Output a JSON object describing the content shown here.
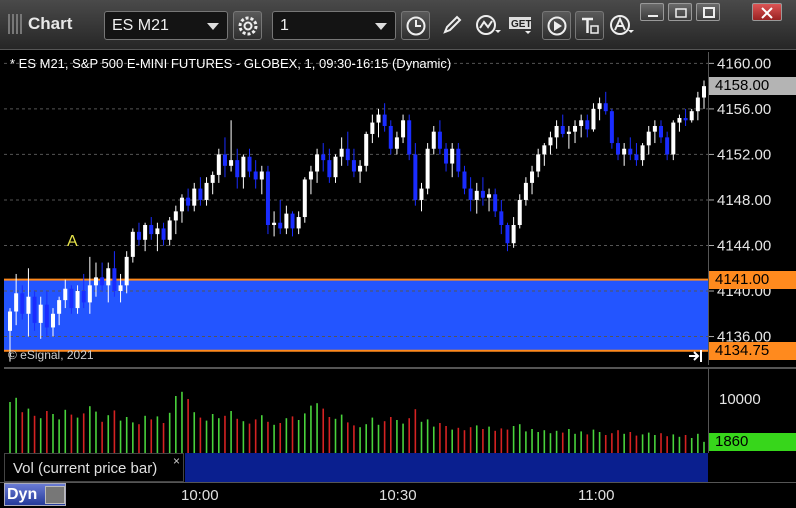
{
  "window": {
    "title": "Chart",
    "minimize_icon": "minimize-icon",
    "restore_icon": "restore-icon",
    "close_icon": "close-icon"
  },
  "toolbar": {
    "symbol": "ES M21",
    "interval": "1",
    "buttons": [
      "gear-icon",
      "clock-icon",
      "pencil-icon",
      "study-icon",
      "get-icon",
      "play-icon",
      "text-icon",
      "alert-icon"
    ],
    "get_label": "GET"
  },
  "chart": {
    "title": "* ES M21, S&P 500 E-MINI FUTURES - GLOBEX, 1, 09:30-16:15 (Dynamic)",
    "copyright": "© eSignal, 2021",
    "marker": "A",
    "current_price": "4158.00",
    "zone_high": "4141.00",
    "zone_low": "4134.75",
    "volume_label": "Vol (current price bar)",
    "volume_value": "1860",
    "volume_tick": "10000",
    "dyn_label": "Dyn",
    "close_x": "×"
  },
  "colors": {
    "up_candle": "#ffffff",
    "down_candle": "#1a2cff",
    "zone_fill": "#2355ff",
    "zone_border": "#ff8a1e",
    "vol_up": "#49d33c",
    "vol_down": "#d62222",
    "current_tag": "#b4b4b4",
    "volume_tag": "#37d61b"
  },
  "chart_data": {
    "type": "candlestick",
    "price_axis": {
      "ticks": [
        "4160.00",
        "4156.00",
        "4152.00",
        "4148.00",
        "4144.00",
        "4140.00",
        "4136.00"
      ],
      "min": 4133.5,
      "max": 4161
    },
    "time_axis": {
      "ticks": [
        "10:00",
        "10:30",
        "11:00"
      ]
    },
    "volume_axis": {
      "ticks": [
        "10000"
      ],
      "max": 14000
    },
    "candles": [
      [
        4136.5,
        4138.5,
        4133.8,
        4138.2
      ],
      [
        4138.2,
        4141.5,
        4137.0,
        4139.8
      ],
      [
        4139.8,
        4140.5,
        4137.5,
        4138.0
      ],
      [
        4138.0,
        4142.0,
        4136.0,
        4139.5
      ],
      [
        4139.5,
        4140.0,
        4136.5,
        4137.2
      ],
      [
        4137.2,
        4139.5,
        4135.8,
        4138.8
      ],
      [
        4138.8,
        4140.0,
        4136.0,
        4136.8
      ],
      [
        4136.8,
        4138.5,
        4136.0,
        4138.0
      ],
      [
        4138.0,
        4139.5,
        4137.0,
        4139.2
      ],
      [
        4139.2,
        4141.0,
        4138.5,
        4140.2
      ],
      [
        4140.2,
        4140.5,
        4138.0,
        4138.5
      ],
      [
        4138.5,
        4140.5,
        4138.0,
        4140.0
      ],
      [
        4140.0,
        4141.5,
        4138.5,
        4139.0
      ],
      [
        4139.0,
        4143.0,
        4138.0,
        4140.5
      ],
      [
        4140.5,
        4142.5,
        4139.5,
        4141.2
      ],
      [
        4141.2,
        4142.5,
        4140.0,
        4140.5
      ],
      [
        4140.5,
        4142.5,
        4139.0,
        4142.0
      ],
      [
        4142.0,
        4143.5,
        4139.5,
        4140.0
      ],
      [
        4140.0,
        4141.5,
        4139.0,
        4140.5
      ],
      [
        4140.5,
        4143.5,
        4139.8,
        4143.0
      ],
      [
        4143.0,
        4145.5,
        4142.5,
        4145.2
      ],
      [
        4145.2,
        4146.0,
        4144.0,
        4144.5
      ],
      [
        4144.5,
        4146.0,
        4143.5,
        4145.8
      ],
      [
        4145.8,
        4146.5,
        4144.5,
        4145.0
      ],
      [
        4145.0,
        4146.0,
        4143.5,
        4145.5
      ],
      [
        4145.5,
        4146.0,
        4144.0,
        4144.5
      ],
      [
        4144.5,
        4146.5,
        4144.0,
        4146.2
      ],
      [
        4146.2,
        4147.5,
        4145.0,
        4147.0
      ],
      [
        4147.0,
        4148.5,
        4146.0,
        4148.2
      ],
      [
        4148.2,
        4149.0,
        4147.0,
        4147.5
      ],
      [
        4147.5,
        4149.5,
        4147.0,
        4149.0
      ],
      [
        4149.0,
        4150.0,
        4147.5,
        4148.0
      ],
      [
        4148.0,
        4150.0,
        4147.5,
        4149.5
      ],
      [
        4149.5,
        4150.5,
        4148.5,
        4150.2
      ],
      [
        4150.2,
        4152.5,
        4149.5,
        4152.0
      ],
      [
        4152.0,
        4153.5,
        4150.0,
        4151.0
      ],
      [
        4151.0,
        4155.0,
        4150.5,
        4151.5
      ],
      [
        4151.5,
        4152.5,
        4149.0,
        4150.0
      ],
      [
        4150.0,
        4152.0,
        4149.0,
        4151.8
      ],
      [
        4151.8,
        4152.5,
        4150.0,
        4150.5
      ],
      [
        4150.5,
        4151.5,
        4149.0,
        4149.8
      ],
      [
        4149.8,
        4151.0,
        4148.5,
        4150.5
      ],
      [
        4150.5,
        4151.0,
        4145.0,
        4145.8
      ],
      [
        4145.8,
        4147.0,
        4144.8,
        4146.0
      ],
      [
        4146.0,
        4148.0,
        4145.0,
        4145.5
      ],
      [
        4145.5,
        4147.5,
        4145.0,
        4146.8
      ],
      [
        4146.8,
        4147.0,
        4144.8,
        4145.5
      ],
      [
        4145.5,
        4147.0,
        4145.0,
        4146.5
      ],
      [
        4146.5,
        4150.0,
        4146.0,
        4149.8
      ],
      [
        4149.8,
        4151.0,
        4148.5,
        4150.5
      ],
      [
        4150.5,
        4152.5,
        4149.5,
        4152.0
      ],
      [
        4152.0,
        4153.0,
        4150.5,
        4151.5
      ],
      [
        4151.5,
        4152.5,
        4149.5,
        4150.0
      ],
      [
        4150.0,
        4152.0,
        4149.5,
        4151.8
      ],
      [
        4151.8,
        4153.5,
        4151.0,
        4152.5
      ],
      [
        4152.5,
        4154.0,
        4151.0,
        4151.5
      ],
      [
        4151.5,
        4152.5,
        4150.0,
        4150.5
      ],
      [
        4150.5,
        4151.5,
        4149.5,
        4151.0
      ],
      [
        4151.0,
        4154.0,
        4150.5,
        4153.8
      ],
      [
        4153.8,
        4155.5,
        4153.0,
        4154.8
      ],
      [
        4154.8,
        4156.0,
        4153.5,
        4155.5
      ],
      [
        4155.5,
        4156.5,
        4154.0,
        4154.5
      ],
      [
        4154.5,
        4155.0,
        4152.0,
        4152.5
      ],
      [
        4152.5,
        4154.0,
        4152.0,
        4153.5
      ],
      [
        4153.5,
        4155.5,
        4153.0,
        4155.0
      ],
      [
        4155.0,
        4155.5,
        4151.5,
        4152.0
      ],
      [
        4152.0,
        4153.0,
        4147.5,
        4148.0
      ],
      [
        4148.0,
        4149.5,
        4147.0,
        4149.0
      ],
      [
        4149.0,
        4153.0,
        4148.5,
        4152.5
      ],
      [
        4152.5,
        4154.5,
        4152.0,
        4154.0
      ],
      [
        4154.0,
        4155.0,
        4152.0,
        4152.5
      ],
      [
        4152.5,
        4153.0,
        4150.5,
        4151.2
      ],
      [
        4151.2,
        4153.0,
        4150.0,
        4152.5
      ],
      [
        4152.5,
        4153.0,
        4150.0,
        4150.5
      ],
      [
        4150.5,
        4151.0,
        4148.5,
        4149.0
      ],
      [
        4149.0,
        4150.0,
        4147.0,
        4148.0
      ],
      [
        4148.0,
        4149.5,
        4146.8,
        4148.8
      ],
      [
        4148.8,
        4150.0,
        4147.5,
        4148.2
      ],
      [
        4148.2,
        4149.0,
        4147.0,
        4148.5
      ],
      [
        4148.5,
        4149.0,
        4146.5,
        4147.0
      ],
      [
        4147.0,
        4148.0,
        4145.0,
        4145.8
      ],
      [
        4145.8,
        4146.0,
        4143.5,
        4144.2
      ],
      [
        4144.2,
        4146.5,
        4143.8,
        4145.8
      ],
      [
        4145.8,
        4148.5,
        4145.5,
        4148.0
      ],
      [
        4148.0,
        4150.0,
        4147.5,
        4149.5
      ],
      [
        4149.5,
        4151.0,
        4148.5,
        4150.5
      ],
      [
        4150.5,
        4152.5,
        4150.0,
        4152.0
      ],
      [
        4152.0,
        4153.0,
        4151.0,
        4152.8
      ],
      [
        4152.8,
        4154.0,
        4152.0,
        4153.5
      ],
      [
        4153.5,
        4155.0,
        4152.5,
        4154.5
      ],
      [
        4154.5,
        4155.5,
        4153.5,
        4153.8
      ],
      [
        4153.8,
        4154.5,
        4152.5,
        4154.0
      ],
      [
        4154.0,
        4155.0,
        4153.0,
        4154.5
      ],
      [
        4154.5,
        4155.5,
        4153.5,
        4155.0
      ],
      [
        4155.0,
        4155.5,
        4153.5,
        4154.2
      ],
      [
        4154.2,
        4156.5,
        4154.0,
        4156.0
      ],
      [
        4156.0,
        4157.0,
        4155.0,
        4156.5
      ],
      [
        4156.5,
        4157.5,
        4155.5,
        4155.8
      ],
      [
        4155.8,
        4156.0,
        4152.5,
        4153.0
      ],
      [
        4153.0,
        4153.5,
        4151.5,
        4152.0
      ],
      [
        4152.0,
        4153.0,
        4151.0,
        4152.5
      ],
      [
        4152.5,
        4153.5,
        4151.5,
        4152.0
      ],
      [
        4152.0,
        4153.0,
        4151.0,
        4151.5
      ],
      [
        4151.5,
        4153.0,
        4151.0,
        4152.8
      ],
      [
        4152.8,
        4154.5,
        4152.0,
        4154.0
      ],
      [
        4154.0,
        4155.0,
        4153.0,
        4154.5
      ],
      [
        4154.5,
        4155.0,
        4153.0,
        4153.5
      ],
      [
        4153.5,
        4154.0,
        4151.5,
        4152.0
      ],
      [
        4152.0,
        4155.0,
        4151.5,
        4154.8
      ],
      [
        4154.8,
        4155.5,
        4154.0,
        4155.2
      ],
      [
        4155.2,
        4156.0,
        4154.5,
        4155.0
      ],
      [
        4155.0,
        4156.0,
        4154.8,
        4155.8
      ],
      [
        4155.8,
        4157.5,
        4155.0,
        4157.0
      ],
      [
        4157.0,
        4158.5,
        4156.0,
        4158.0
      ]
    ],
    "volumes": [
      8500,
      9200,
      6800,
      7400,
      6200,
      5800,
      7000,
      6500,
      5600,
      7200,
      6400,
      5900,
      6600,
      7800,
      6900,
      5200,
      6300,
      7100,
      5400,
      6000,
      5100,
      4800,
      6200,
      5600,
      6100,
      5000,
      6700,
      9500,
      10200,
      9000,
      6800,
      5900,
      5400,
      6500,
      5800,
      6200,
      7000,
      5700,
      5300,
      4900,
      5600,
      6300,
      5200,
      4700,
      5000,
      5800,
      6100,
      5500,
      6600,
      7900,
      8300,
      7400,
      6000,
      5700,
      6400,
      5100,
      4600,
      4300,
      4800,
      5900,
      4700,
      5300,
      6000,
      5500,
      4900,
      5800,
      7300,
      5200,
      5600,
      4400,
      5000,
      4500,
      3900,
      4200,
      3800,
      4300,
      4600,
      4000,
      4400,
      3700,
      4100,
      3900,
      4500,
      4800,
      3600,
      4000,
      3500,
      3800,
      3300,
      3700,
      3400,
      4000,
      3200,
      3600,
      3100,
      3900,
      3500,
      3000,
      3300,
      3800,
      3200,
      3500,
      2900,
      3100,
      3400,
      3000,
      3300,
      2800,
      3100,
      2700,
      3000,
      2500,
      3200,
      1860
    ],
    "current_price": 4158.0,
    "zone": {
      "high": 4141.0,
      "low": 4134.75
    }
  }
}
